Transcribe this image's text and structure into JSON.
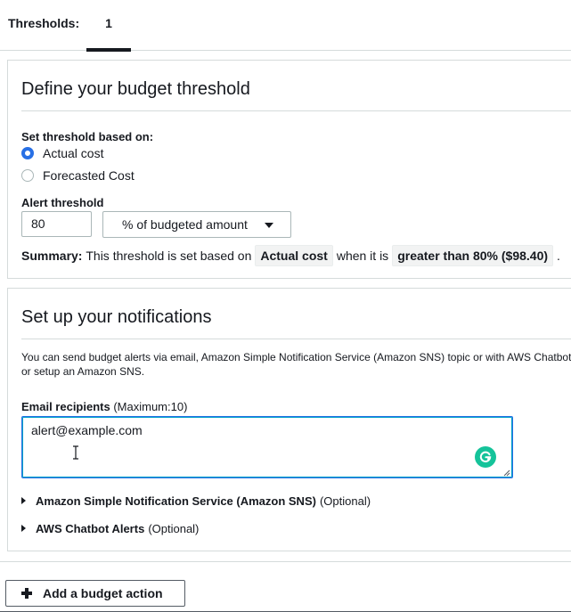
{
  "tabs": {
    "label": "Thresholds:",
    "active": "1"
  },
  "threshold_panel": {
    "title": "Define your budget threshold",
    "based_on_label": "Set threshold based on:",
    "options": [
      {
        "label": "Actual cost",
        "selected": true
      },
      {
        "label": "Forecasted Cost",
        "selected": false
      }
    ],
    "alert_label": "Alert threshold",
    "alert_value": "80",
    "alert_unit": "% of budgeted amount",
    "summary": {
      "prefix": "Summary:",
      "text1": "This threshold is set based on",
      "chip1": "Actual cost",
      "text2": "when it is",
      "chip2": "greater than 80% ($98.40)",
      "end": "."
    }
  },
  "notifications_panel": {
    "title": "Set up your notifications",
    "description_line1": "You can send budget alerts via email, Amazon Simple Notification Service (Amazon SNS) topic or with AWS Chatbot",
    "description_line2": "or setup an Amazon SNS.",
    "email_label": "Email recipients",
    "email_hint": "(Maximum:10)",
    "email_value": "alert@example.com",
    "sns_label": "Amazon Simple Notification Service (Amazon SNS)",
    "sns_optional": "(Optional)",
    "chatbot_label": "AWS Chatbot Alerts",
    "chatbot_optional": "(Optional)"
  },
  "actions": {
    "add_budget_action": "Add a budget action"
  },
  "colors": {
    "accent": "#2870e5",
    "grammarly": "#15c39a",
    "border": "#d5dbdb"
  },
  "icons": [
    "radio-selected-icon",
    "radio-unselected-icon",
    "caret-down-icon",
    "text-cursor-icon",
    "grammarly-icon",
    "resize-handle-icon",
    "expand-triangle-icon",
    "plus-icon"
  ]
}
